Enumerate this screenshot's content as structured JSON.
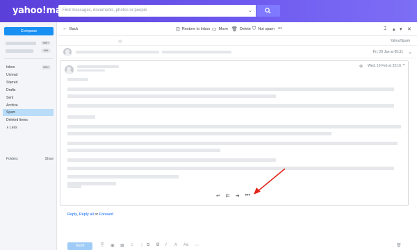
{
  "header": {
    "logo": "yahoo!mail",
    "search_placeholder": "Find messages, documents, photos or people"
  },
  "sidebar": {
    "compose_label": "Compose",
    "account_badges": [
      "999+",
      "999"
    ],
    "items": [
      {
        "label": "Inbox",
        "badge": "999+"
      },
      {
        "label": "Unread"
      },
      {
        "label": "Starred"
      },
      {
        "label": "Drafts"
      },
      {
        "label": "Sent"
      },
      {
        "label": "Archive"
      },
      {
        "label": "Spam",
        "active": true
      },
      {
        "label": "Deleted Items"
      },
      {
        "label": "∧ Less"
      }
    ],
    "folders_label": "Folders",
    "folders_show": "Show"
  },
  "toolbar": {
    "back": "Back",
    "restore": "Restore to Inbox",
    "move": "Move",
    "delete": "Delete",
    "not_spam": "Not spam",
    "more": "•••"
  },
  "thread": {
    "folder_tag": "Yahoo/Spam",
    "date1": "Fri, 29 Jan at 05:31",
    "date2": "Wed, 10 Feb at 23:16"
  },
  "reply_bar": {
    "reply": "Reply",
    "reply_all": "Reply all",
    "or": "or",
    "forward": "Forward"
  },
  "compose_bottom": {
    "send": "Send"
  },
  "colors": {
    "topbar": "#5a3fd8",
    "compose": "#1890f3",
    "active_folder": "#b9dcf8",
    "annotation_arrow": "#e0261b"
  }
}
